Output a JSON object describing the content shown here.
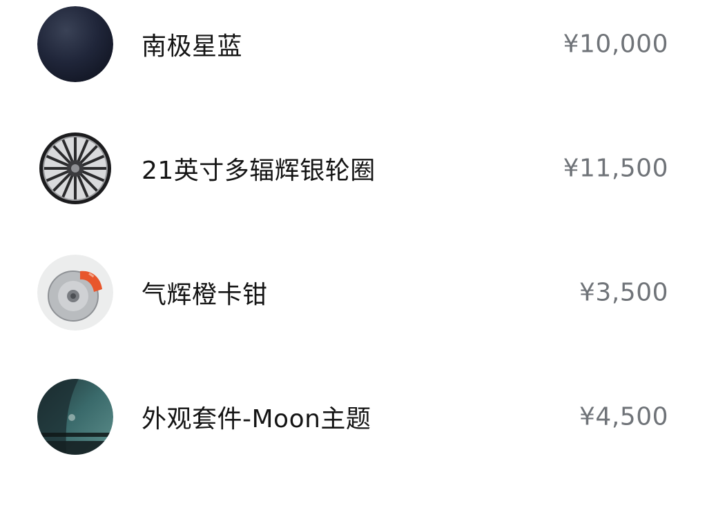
{
  "options": [
    {
      "icon": "paint-swatch-icon",
      "name": "南极星蓝",
      "price": "¥10,000"
    },
    {
      "icon": "wheel-rim-icon",
      "name": "21英寸多辐辉银轮圈",
      "price": "¥11,500"
    },
    {
      "icon": "brake-caliper-icon",
      "name": "气辉橙卡钳",
      "price": "¥3,500"
    },
    {
      "icon": "exterior-kit-icon",
      "name": "外观套件-Moon主题",
      "price": "¥4,500"
    }
  ],
  "colors": {
    "swatch_dark": "#1e2330",
    "caliper_orange": "#e8562c",
    "kit_teal": "#2f5a5c",
    "price_gray": "#6f7378"
  }
}
